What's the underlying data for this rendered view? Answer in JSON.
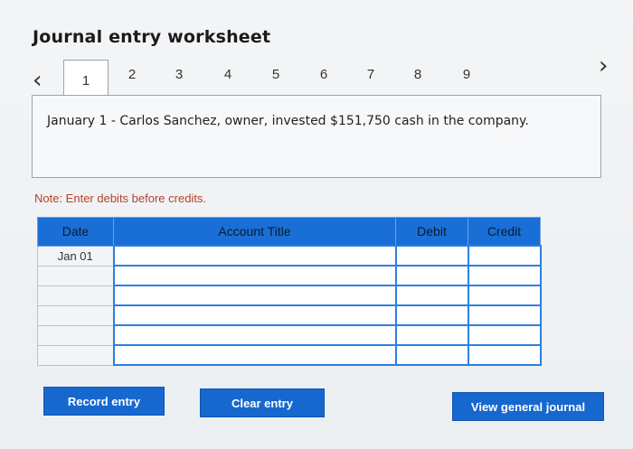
{
  "title": "Journal entry worksheet",
  "tabs": [
    "1",
    "2",
    "3",
    "4",
    "5",
    "6",
    "7",
    "8",
    "9"
  ],
  "active_tab": "1",
  "transaction": "January 1 - Carlos Sanchez, owner, invested $151,750 cash in the company.",
  "note": "Note: Enter debits before credits.",
  "table": {
    "headers": [
      "Date",
      "Account Title",
      "Debit",
      "Credit"
    ],
    "rows": [
      [
        "Jan 01",
        "",
        "",
        ""
      ],
      [
        "",
        "",
        "",
        ""
      ],
      [
        "",
        "",
        "",
        ""
      ],
      [
        "",
        "",
        "",
        ""
      ],
      [
        "",
        "",
        "",
        ""
      ],
      [
        "",
        "",
        "",
        ""
      ]
    ]
  },
  "buttons": {
    "record": "Record entry",
    "clear": "Clear entry",
    "view": "View general journal"
  },
  "icons": {
    "prev": "chevron-left-icon",
    "next": "chevron-right-icon"
  },
  "colors": {
    "accent": "#1a6fd6",
    "note": "#b1442a"
  }
}
